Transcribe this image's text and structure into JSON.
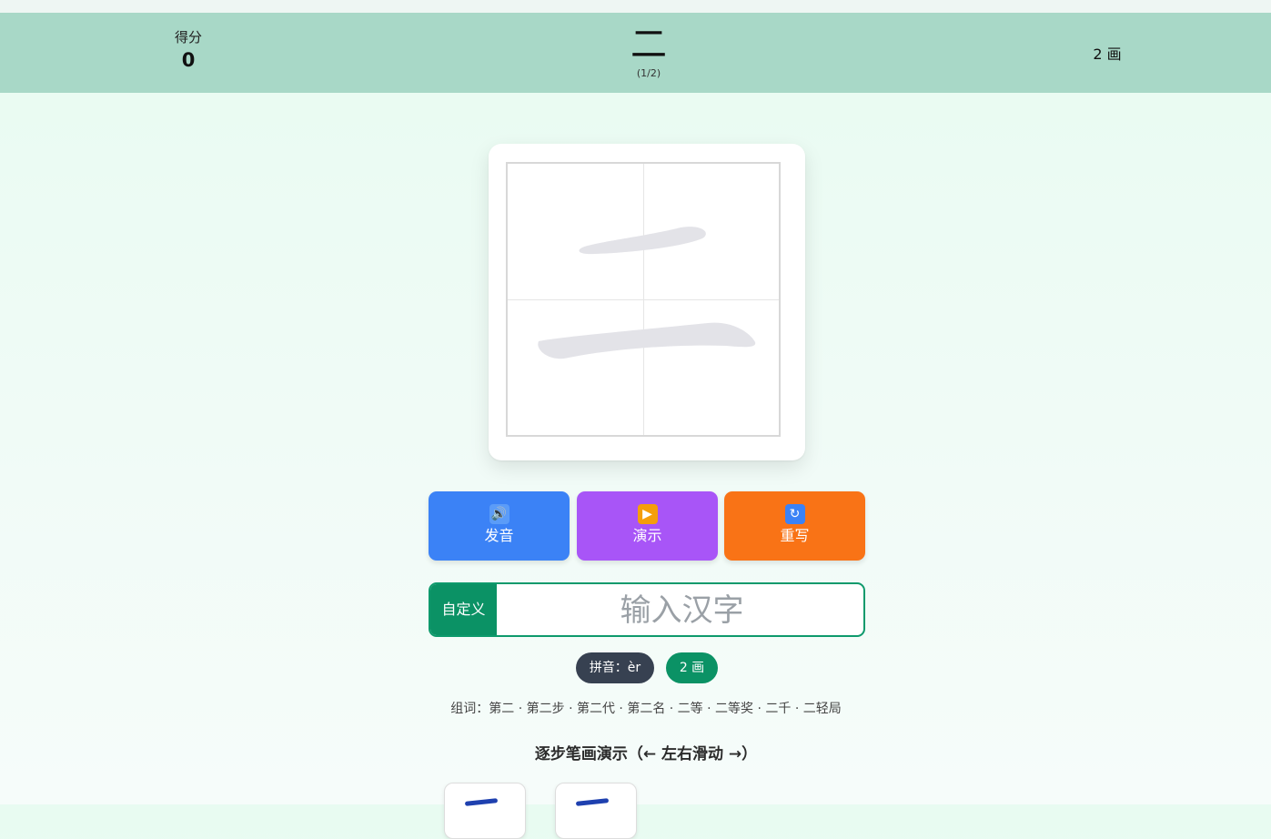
{
  "header": {
    "score_label": "得分",
    "score_value": "0",
    "character": "二",
    "progress": "(1/2)",
    "stroke_count": "2 画"
  },
  "actions": {
    "speak": {
      "icon": "speaker-icon",
      "label": "发音"
    },
    "demo": {
      "icon": "play-icon",
      "label": "演示"
    },
    "rewrite": {
      "icon": "refresh-icon",
      "label": "重写"
    }
  },
  "custom": {
    "label": "自定义",
    "placeholder": "输入汉字",
    "value": ""
  },
  "info": {
    "pinyin": "拼音：èr",
    "strokes": "2 画"
  },
  "words": "组词：第二 · 第二步 · 第二代 · 第二名 · 二等 · 二等奖 · 二千 · 二轻局",
  "step_demo": {
    "title": "逐步笔画演示（← 左右滑动 →）"
  },
  "colors": {
    "header_bg": "#a8d8c7",
    "speak_btn": "#3b82f6",
    "demo_btn": "#a855f7",
    "rewrite_btn": "#f97316",
    "accent_green": "#0b9265",
    "pinyin_pill": "#374151",
    "stroke_blue": "#1e40af"
  }
}
